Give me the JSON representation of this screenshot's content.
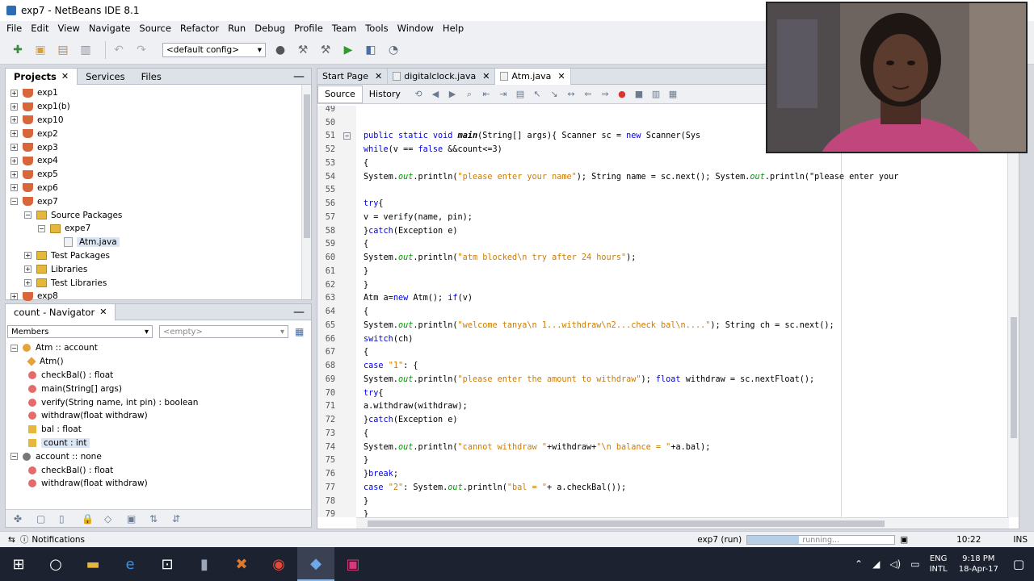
{
  "window": {
    "title": "exp7 - NetBeans IDE 8.1"
  },
  "menu": [
    "File",
    "Edit",
    "View",
    "Navigate",
    "Source",
    "Refactor",
    "Run",
    "Debug",
    "Profile",
    "Team",
    "Tools",
    "Window",
    "Help"
  ],
  "toolbar": {
    "config": "<default config>"
  },
  "projects_pane": {
    "tabs": [
      {
        "label": "Projects",
        "active": true
      },
      {
        "label": "Services",
        "active": false
      },
      {
        "label": "Files",
        "active": false
      }
    ],
    "tree": [
      {
        "label": "exp1",
        "level": 0,
        "icon": "project"
      },
      {
        "label": "exp1(b)",
        "level": 0,
        "icon": "project"
      },
      {
        "label": "exp10",
        "level": 0,
        "icon": "project"
      },
      {
        "label": "exp2",
        "level": 0,
        "icon": "project"
      },
      {
        "label": "exp3",
        "level": 0,
        "icon": "project"
      },
      {
        "label": "exp4",
        "level": 0,
        "icon": "project"
      },
      {
        "label": "exp5",
        "level": 0,
        "icon": "project"
      },
      {
        "label": "exp6",
        "level": 0,
        "icon": "project"
      },
      {
        "label": "exp7",
        "level": 0,
        "icon": "project",
        "expanded": true
      },
      {
        "label": "Source Packages",
        "level": 1,
        "icon": "folder",
        "expanded": true
      },
      {
        "label": "expe7",
        "level": 2,
        "icon": "package",
        "expanded": true
      },
      {
        "label": "Atm.java",
        "level": 3,
        "icon": "java",
        "selected": true
      },
      {
        "label": "Test Packages",
        "level": 1,
        "icon": "folder"
      },
      {
        "label": "Libraries",
        "level": 1,
        "icon": "library"
      },
      {
        "label": "Test Libraries",
        "level": 1,
        "icon": "library"
      },
      {
        "label": "exp8",
        "level": 0,
        "icon": "project"
      }
    ]
  },
  "navigator": {
    "title": "count - Navigator",
    "filter": "Members",
    "empty": "<empty>",
    "members": [
      {
        "label": "Atm :: account",
        "level": 0,
        "icon": "class"
      },
      {
        "label": "Atm()",
        "level": 1,
        "icon": "constructor"
      },
      {
        "label": "checkBal() : float",
        "level": 1,
        "icon": "method"
      },
      {
        "label": "main(String[] args)",
        "level": 1,
        "icon": "static-method"
      },
      {
        "label": "verify(String name, int pin) : boolean",
        "level": 1,
        "icon": "static-method"
      },
      {
        "label": "withdraw(float withdraw)",
        "level": 1,
        "icon": "method"
      },
      {
        "label": "bal : float",
        "level": 1,
        "icon": "field"
      },
      {
        "label": "count : int",
        "level": 1,
        "icon": "field",
        "selected": true
      },
      {
        "label": "account :: none",
        "level": 0,
        "icon": "interface"
      },
      {
        "label": "checkBal() : float",
        "level": 1,
        "icon": "method"
      },
      {
        "label": "withdraw(float withdraw)",
        "level": 1,
        "icon": "method"
      }
    ]
  },
  "editor": {
    "tabs": [
      {
        "label": "Start Page",
        "active": false
      },
      {
        "label": "digitalclock.java",
        "active": false
      },
      {
        "label": "Atm.java",
        "active": true
      }
    ],
    "source_label": "Source",
    "history_label": "History",
    "lines": [
      {
        "n": "49",
        "t": ""
      },
      {
        "n": "50",
        "t": ""
      },
      {
        "n": "51",
        "t": "public static void main(String[] args){ Scanner sc = new Scanner(Sys",
        "fold": true
      },
      {
        "n": "52",
        "t": "while(v == false &&count<=3)"
      },
      {
        "n": "53",
        "t": "{"
      },
      {
        "n": "54",
        "t": "System.out.println(\"please enter your name\"); String name = sc.next(); System.out.println(\"please enter your"
      },
      {
        "n": "55",
        "t": ""
      },
      {
        "n": "56",
        "t": "try{"
      },
      {
        "n": "57",
        "t": "v = verify(name, pin);"
      },
      {
        "n": "58",
        "t": "}catch(Exception e)"
      },
      {
        "n": "59",
        "t": "{"
      },
      {
        "n": "60",
        "t": "System.out.println(\"atm blocked\\n try after 24 hours\");"
      },
      {
        "n": "61",
        "t": "}"
      },
      {
        "n": "62",
        "t": "}"
      },
      {
        "n": "63",
        "t": "Atm a=new Atm(); if(v)"
      },
      {
        "n": "64",
        "t": "{"
      },
      {
        "n": "65",
        "t": "System.out.println(\"welcome tanya\\n 1...withdraw\\n2...check bal\\n....\"); String ch = sc.next();"
      },
      {
        "n": "66",
        "t": "switch(ch)"
      },
      {
        "n": "67",
        "t": "{"
      },
      {
        "n": "68",
        "t": "case \"1\": {"
      },
      {
        "n": "69",
        "t": "System.out.println(\"please enter the amount to withdraw\"); float withdraw = sc.nextFloat();"
      },
      {
        "n": "70",
        "t": "try{"
      },
      {
        "n": "71",
        "t": "a.withdraw(withdraw);"
      },
      {
        "n": "72",
        "t": "}catch(Exception e)"
      },
      {
        "n": "73",
        "t": "{"
      },
      {
        "n": "74",
        "t": "System.out.println(\"cannot withdraw \"+withdraw+\"\\n balance = \"+a.bal);"
      },
      {
        "n": "75",
        "t": "}"
      },
      {
        "n": "76",
        "t": "}break;"
      },
      {
        "n": "77",
        "t": "case \"2\": System.out.println(\"bal = \"+ a.checkBal());"
      },
      {
        "n": "78",
        "t": "}"
      },
      {
        "n": "79",
        "t": "}"
      }
    ]
  },
  "status": {
    "notifications": "Notifications",
    "project": "exp7 (run)",
    "progress_text": "running...",
    "progress": 0.35,
    "position": "10:22",
    "mode": "INS"
  },
  "taskbar": {
    "lang_1": "ENG",
    "lang_2": "INTL",
    "time": "9:18 PM",
    "date": "18-Apr-17"
  }
}
